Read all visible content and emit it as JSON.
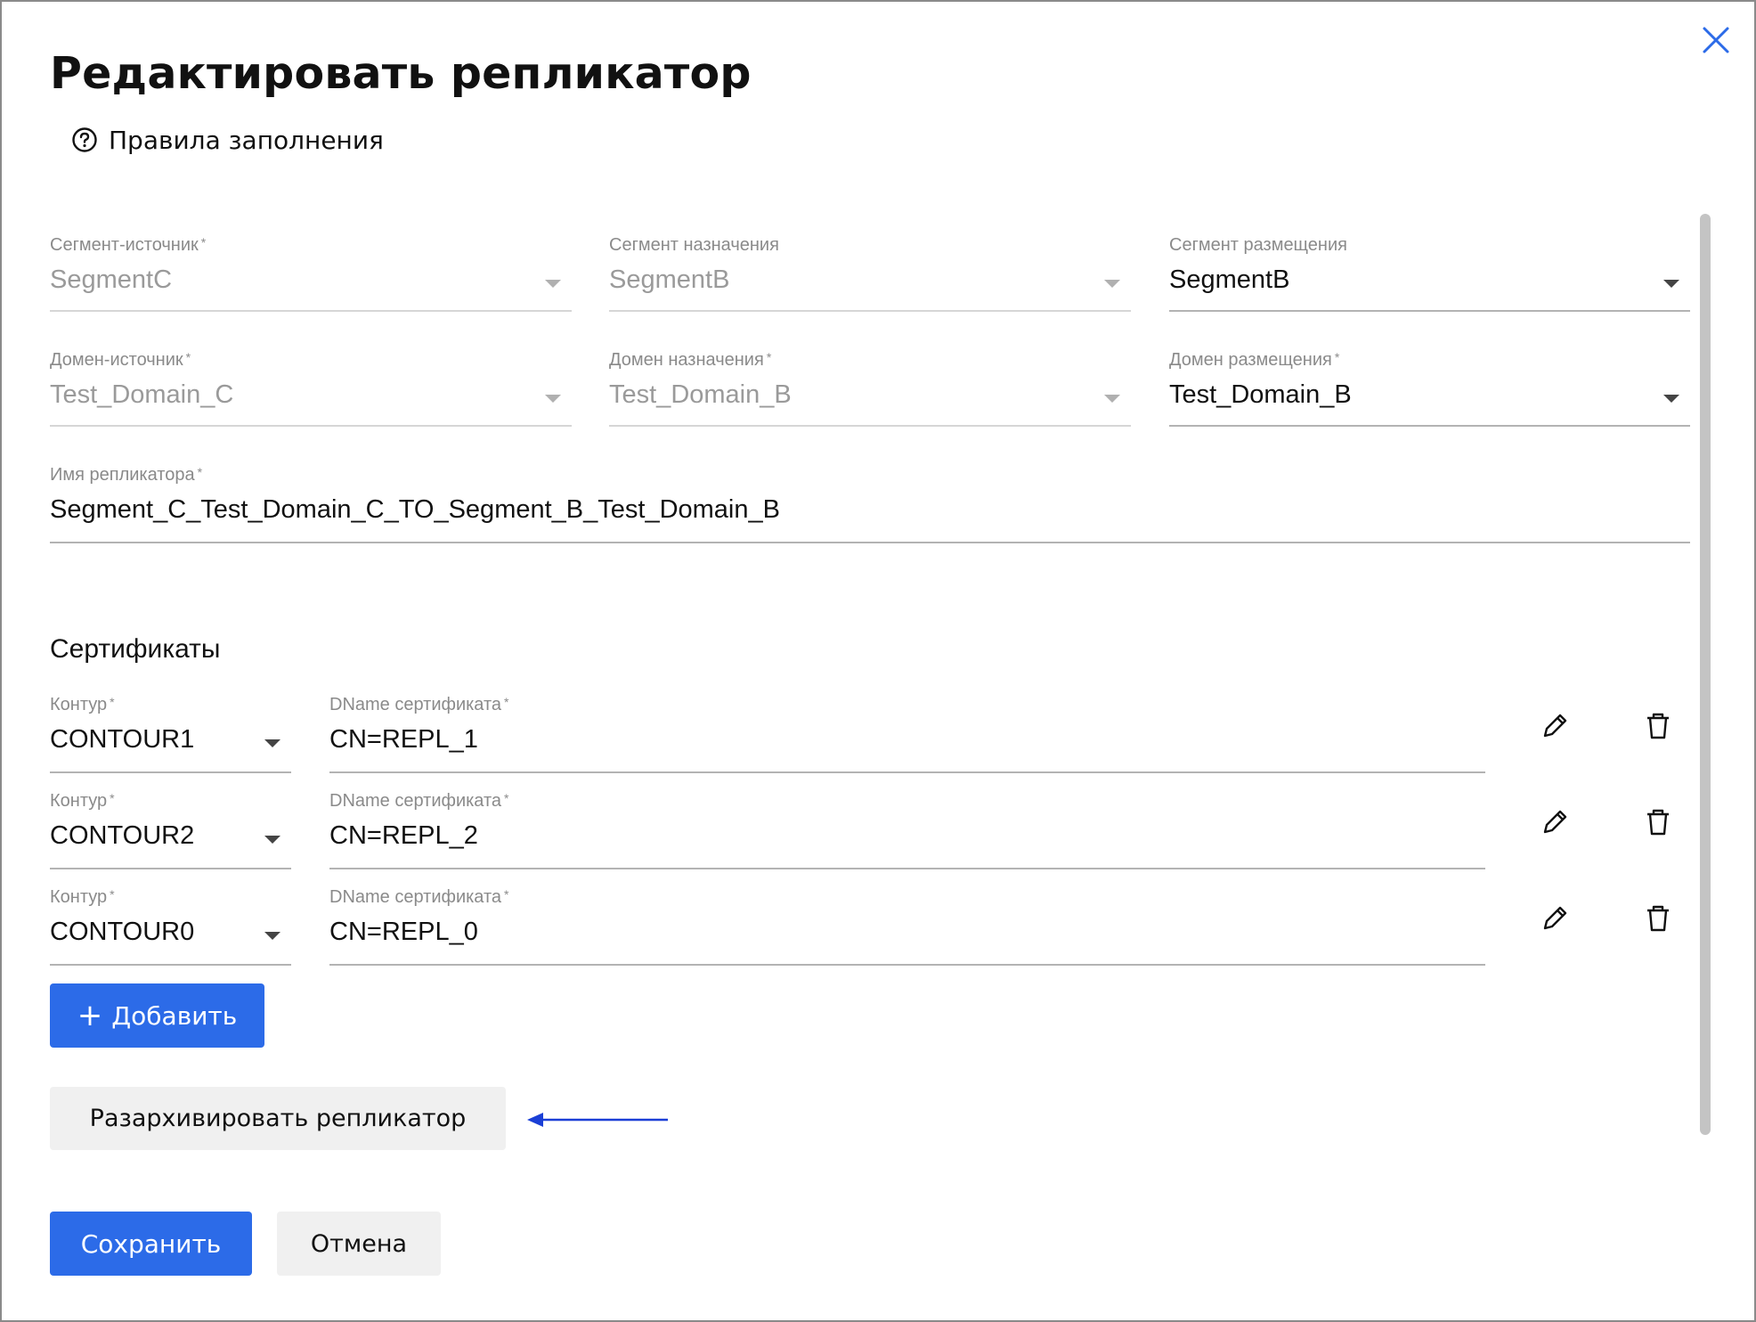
{
  "dialog": {
    "title": "Редактировать репликатор",
    "help_link": "Правила заполнения",
    "close_icon": "close-icon",
    "accent_color": "#2c6be8"
  },
  "fields": {
    "source_segment": {
      "label": "Сегмент-источник",
      "required": "*",
      "value": "SegmentC",
      "disabled": true
    },
    "target_segment": {
      "label": "Сегмент назначения",
      "value": "SegmentB",
      "disabled": true
    },
    "placement_segment": {
      "label": "Сегмент размещения",
      "value": "SegmentB",
      "disabled": false
    },
    "source_domain": {
      "label": "Домен-источник",
      "required": "*",
      "value": "Test_Domain_C",
      "disabled": true
    },
    "target_domain": {
      "label": "Домен назначения",
      "required": "*",
      "value": "Test_Domain_B",
      "disabled": true
    },
    "placement_domain": {
      "label": "Домен размещения",
      "required": "*",
      "value": "Test_Domain_B",
      "disabled": false
    },
    "replicator_name": {
      "label": "Имя репликатора",
      "required": "*",
      "value": "Segment_C_Test_Domain_C_TO_Segment_B_Test_Domain_B"
    }
  },
  "certificates": {
    "title": "Сертификаты",
    "rows": [
      {
        "contour_label": "Контур",
        "contour_value": "CONTOUR1",
        "dname_label": "DName сертификата",
        "dname_value": "CN=REPL_1",
        "required": "*"
      },
      {
        "contour_label": "Контур",
        "contour_value": "CONTOUR2",
        "dname_label": "DName сертификата",
        "dname_value": "CN=REPL_2",
        "required": "*"
      },
      {
        "contour_label": "Контур",
        "contour_value": "CONTOUR0",
        "dname_label": "DName сертификата",
        "dname_value": "CN=REPL_0",
        "required": "*"
      }
    ],
    "add_button": "Добавить",
    "edit_icon": "pencil-icon",
    "delete_icon": "trash-icon"
  },
  "unarchive_button": "Разархивировать репликатор",
  "footer": {
    "save_button": "Сохранить",
    "cancel_button": "Отмена"
  }
}
